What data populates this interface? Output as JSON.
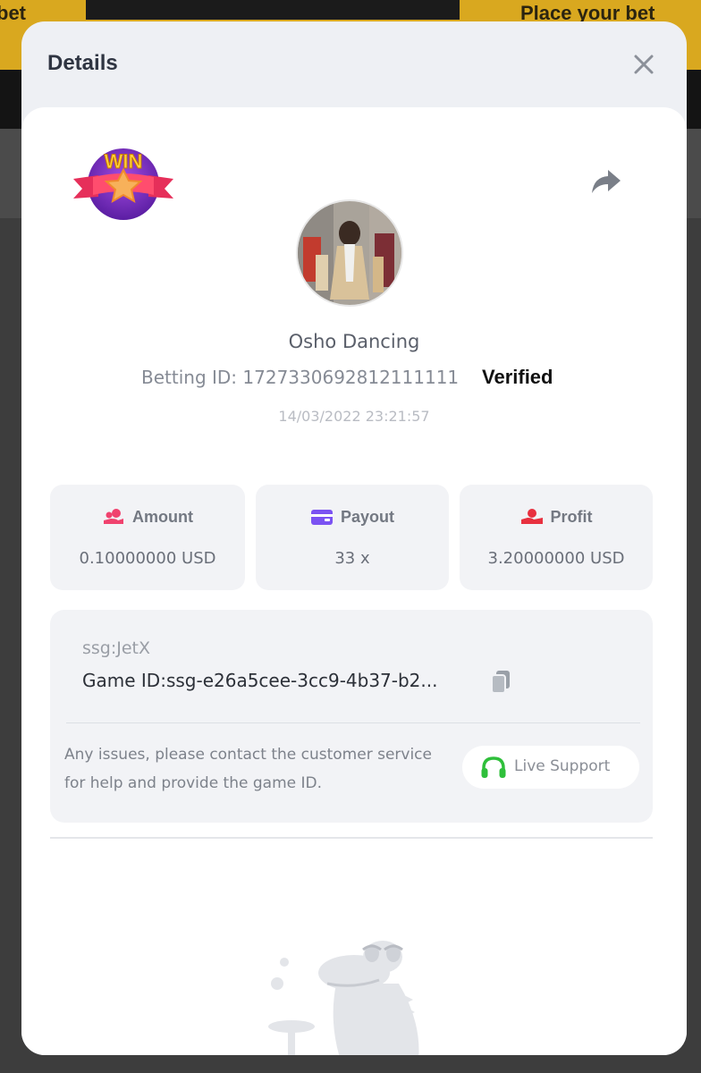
{
  "background": {
    "left_text": "bet",
    "right_text": "Place your bet"
  },
  "modal": {
    "title": "Details",
    "close_icon": "close-icon"
  },
  "bet": {
    "badge_text": "WIN",
    "username": "Osho Dancing",
    "betting_id_label": "Betting ID:",
    "betting_id": "1727330692812111111",
    "verified": "Verified",
    "timestamp": "14/03/2022 23:21:57"
  },
  "stats": {
    "amount": {
      "label": "Amount",
      "value": "0.10000000 USD",
      "icon": "coins-hand-icon",
      "color": "#f0426e"
    },
    "payout": {
      "label": "Payout",
      "value": "33 x",
      "icon": "wallet-card-icon",
      "color": "#7b52f2"
    },
    "profit": {
      "label": "Profit",
      "value": "3.20000000 USD",
      "icon": "money-hand-icon",
      "color": "#e8303f"
    }
  },
  "game": {
    "provider": "ssg:JetX",
    "game_id_label": "Game ID:",
    "game_id": "ssg-e26a5cee-3cc9-4b37-b2...",
    "issues_text": "Any issues, please contact the customer service for help and provide the game ID.",
    "support_label": "Live Support",
    "support_color": "#2fbf3b"
  }
}
